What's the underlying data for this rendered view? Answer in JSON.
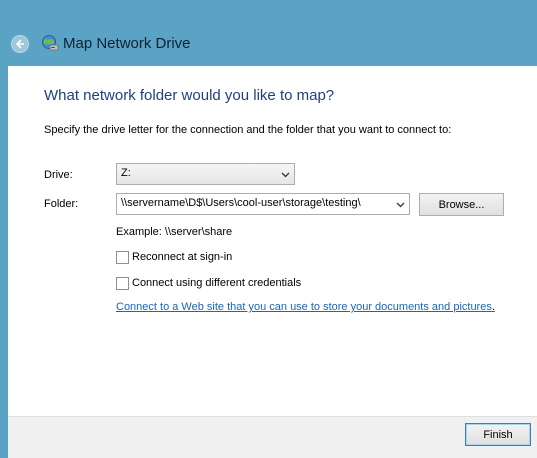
{
  "window": {
    "title": "Map Network Drive"
  },
  "page": {
    "heading": "What network folder would you like to map?",
    "instruction": "Specify the drive letter for the connection and the folder that you want to connect to:"
  },
  "drive": {
    "label": "Drive:",
    "value": "Z:"
  },
  "folder": {
    "label": "Folder:",
    "value": "\\\\servername\\D$\\Users\\cool-user\\storage\\testing\\",
    "browse_label": "Browse..."
  },
  "example_text": "Example: \\\\server\\share",
  "options": {
    "reconnect_label": "Reconnect at sign-in",
    "reconnect_checked": false,
    "credentials_label": "Connect using different credentials",
    "credentials_checked": false
  },
  "link_text": "Connect to a Web site that you can use to store your documents and pictures",
  "footer": {
    "finish_label": "Finish"
  },
  "colors": {
    "titlebar": "#5ba3c4",
    "heading": "#1e3f82",
    "link": "#1a66b8"
  }
}
